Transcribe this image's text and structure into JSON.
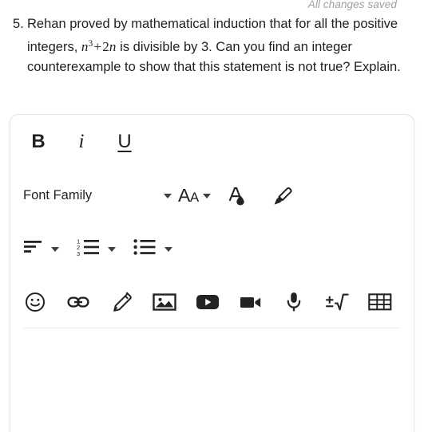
{
  "status": {
    "save_text": "All changes saved"
  },
  "question": {
    "number": "5.",
    "text_part1": "Rehan proved by mathematical induction that for all the positive integers, ",
    "math": {
      "base": "n",
      "exponent": "3",
      "operator": "+",
      "coefficient": "2",
      "variable": "n"
    },
    "text_part2": " is divisible by 3. Can you find an integer counterexample to show that this statement is not true? Explain."
  },
  "editor": {
    "toolbar": {
      "bold_label": "B",
      "italic_label": "i",
      "underline_label": "U",
      "font_family_label": "Font Family",
      "font_size_label": "A",
      "font_size_label_small": "A",
      "icons": {
        "text_color": "text-color-icon",
        "highlight": "highlight-icon",
        "align": "align-left-icon",
        "numbered_list": "numbered-list-icon",
        "bulleted_list": "bulleted-list-icon",
        "emoji": "emoji-icon",
        "link": "link-icon",
        "draw": "pencil-icon",
        "image": "image-icon",
        "youtube": "youtube-icon",
        "video": "video-camera-icon",
        "audio": "microphone-icon",
        "math": "math-equation-icon",
        "table": "table-icon"
      }
    }
  },
  "colors": {
    "text": "#1f1f1f",
    "muted": "#9aa0a6",
    "icon": "#232323",
    "card_border": "#e3e3e3",
    "divider": "#ececec",
    "background": "#ffffff"
  }
}
